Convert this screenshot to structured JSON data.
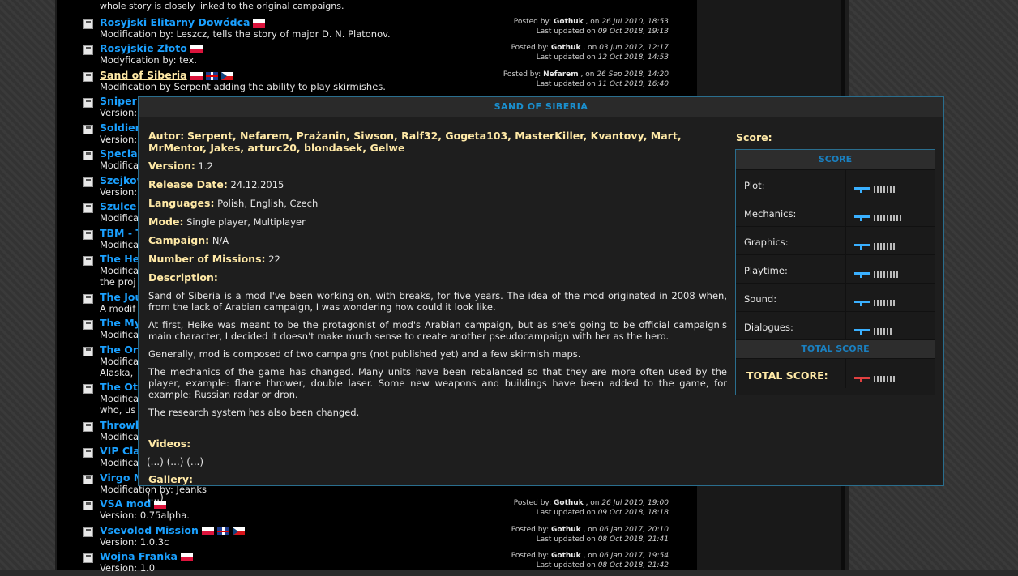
{
  "list": {
    "top_text": "whole story is closely linked to the original campaigns.",
    "posted_by_label": "Posted by:",
    "on_label": ", on",
    "updated_label": "Last updated on",
    "items": [
      {
        "title": "Rosyjski Elitarny Dowódca",
        "desc": "Modification by: Leszcz, tells the story of major D. N. Platonov.",
        "author": "Gothuk",
        "posted": "26 Jul 2010, 18:53",
        "updated": "09 Oct 2018, 19:13"
      },
      {
        "title": "Rosyjskie Złoto",
        "desc": "Modyfication by: tex.",
        "author": "Gothuk",
        "posted": "03 Jun 2012, 12:17",
        "updated": "12 Oct 2018, 14:53"
      },
      {
        "title": "Sand of Siberia",
        "desc": "Modification by Serpent adding the ability to play skirmishes.",
        "author": "Nefarem",
        "posted": "26 Sep 2018, 14:20",
        "updated": "11 Oct 2018, 16:40"
      },
      {
        "title": "Sniper",
        "desc": "Version:"
      },
      {
        "title": "Soldiers",
        "desc": "Version:"
      },
      {
        "title": "Special",
        "desc": "Modificat"
      },
      {
        "title": "Szejkow",
        "desc": "Version:"
      },
      {
        "title": "Szulce I",
        "desc": "Modificat"
      },
      {
        "title": "TBM - T",
        "desc": "Modificat"
      },
      {
        "title": "The Her",
        "desc": "Modificat",
        "desc2": "the proj"
      },
      {
        "title": "The Jou",
        "desc": "A modif"
      },
      {
        "title": "The Mys",
        "desc": "Modificat"
      },
      {
        "title": "The Org",
        "desc": "Modificat",
        "desc2": "Alaska,"
      },
      {
        "title": "The Oth",
        "desc": "Modificat",
        "desc2": "who, us"
      },
      {
        "title": "Throwb",
        "desc": "Modificat"
      },
      {
        "title": "VIP Cla",
        "desc": "Modificat"
      },
      {
        "title": "Virgo M",
        "desc": "Modification by: Jeanks"
      },
      {
        "title": "VSA mod",
        "desc": "Version: 0.75alpha.",
        "author": "Gothuk",
        "posted": "26 Jul 2010, 19:00",
        "updated": "09 Oct 2018, 18:18"
      },
      {
        "title": "Vsevolod Mission",
        "desc": "Version: 1.0.3c",
        "author": "Gothuk",
        "posted": "06 Jan 2017, 20:10",
        "updated": "08 Oct 2018, 21:41"
      },
      {
        "title": "Wojna Franka",
        "desc": "Version: 1.0",
        "author": "Gothuk",
        "posted": "06 Jan 2017, 19:54",
        "updated": "08 Oct 2018, 21:42"
      }
    ]
  },
  "popup": {
    "header": "SAND OF SIBERIA",
    "autor_label": "Autor:",
    "authors": "Serpent, Nefarem, Prażanin, Siwson, Ralf32, Gogeta103, MasterKiller, Kvantovy, Mart, MrMentor, Jakes, arturc20, blondasek, Gelwe",
    "version_label": "Version:",
    "version": "1.2",
    "release_label": "Release Date:",
    "release": "24.12.2015",
    "languages_label": "Languages:",
    "languages": "Polish, English, Czech",
    "mode_label": "Mode:",
    "mode": "Single player, Multiplayer",
    "campaign_label": "Campaign:",
    "campaign": "N/A",
    "missions_label": "Number of Missions:",
    "missions": "22",
    "description_label": "Description:",
    "description": [
      "Sand of Siberia is a mod I've been working on, with breaks, for five years. The idea of the mod originated in 2008 when, from the lack of Arabian campaign, I was wondering how could it look like.",
      "At first, Heike was meant to be the protagonist of mod's Arabian campaign, but as she's going to be official campaign's main character, I decided it doesn't make much sense to create another pseudocampaign with her as the hero.",
      "Generally, mod is composed of two campaigns (not published yet) and a few skirmish maps.",
      "The mechanics of the game has changed. Many units have been rebalanced so that they are more often used by the player, example: flame thrower, double laser. Some new weapons and buildings have been added to the game, for example: Russian radar or dron.",
      "The research system has also been changed."
    ],
    "videos_label": "Videos:",
    "videos": "(...) (...) (...)",
    "gallery_label": "Gallery:",
    "gallery": "(...)",
    "score_label": "Score:",
    "score_header": "SCORE",
    "scores": [
      {
        "name": "Plot:",
        "value": 7,
        "max": 10
      },
      {
        "name": "Mechanics:",
        "value": 9,
        "max": 10
      },
      {
        "name": "Graphics:",
        "value": 7,
        "max": 10
      },
      {
        "name": "Playtime:",
        "value": 8,
        "max": 10
      },
      {
        "name": "Sound:",
        "value": 7,
        "max": 10
      },
      {
        "name": "Dialogues:",
        "value": 6,
        "max": 10
      }
    ],
    "total_header": "TOTAL SCORE",
    "total_label": "TOTAL SCORE:",
    "total_value": 7,
    "total_max": 10,
    "colors": {
      "accent": "#1a90d0",
      "label": "#ffe9a6",
      "link": "#1aa0ff"
    }
  }
}
